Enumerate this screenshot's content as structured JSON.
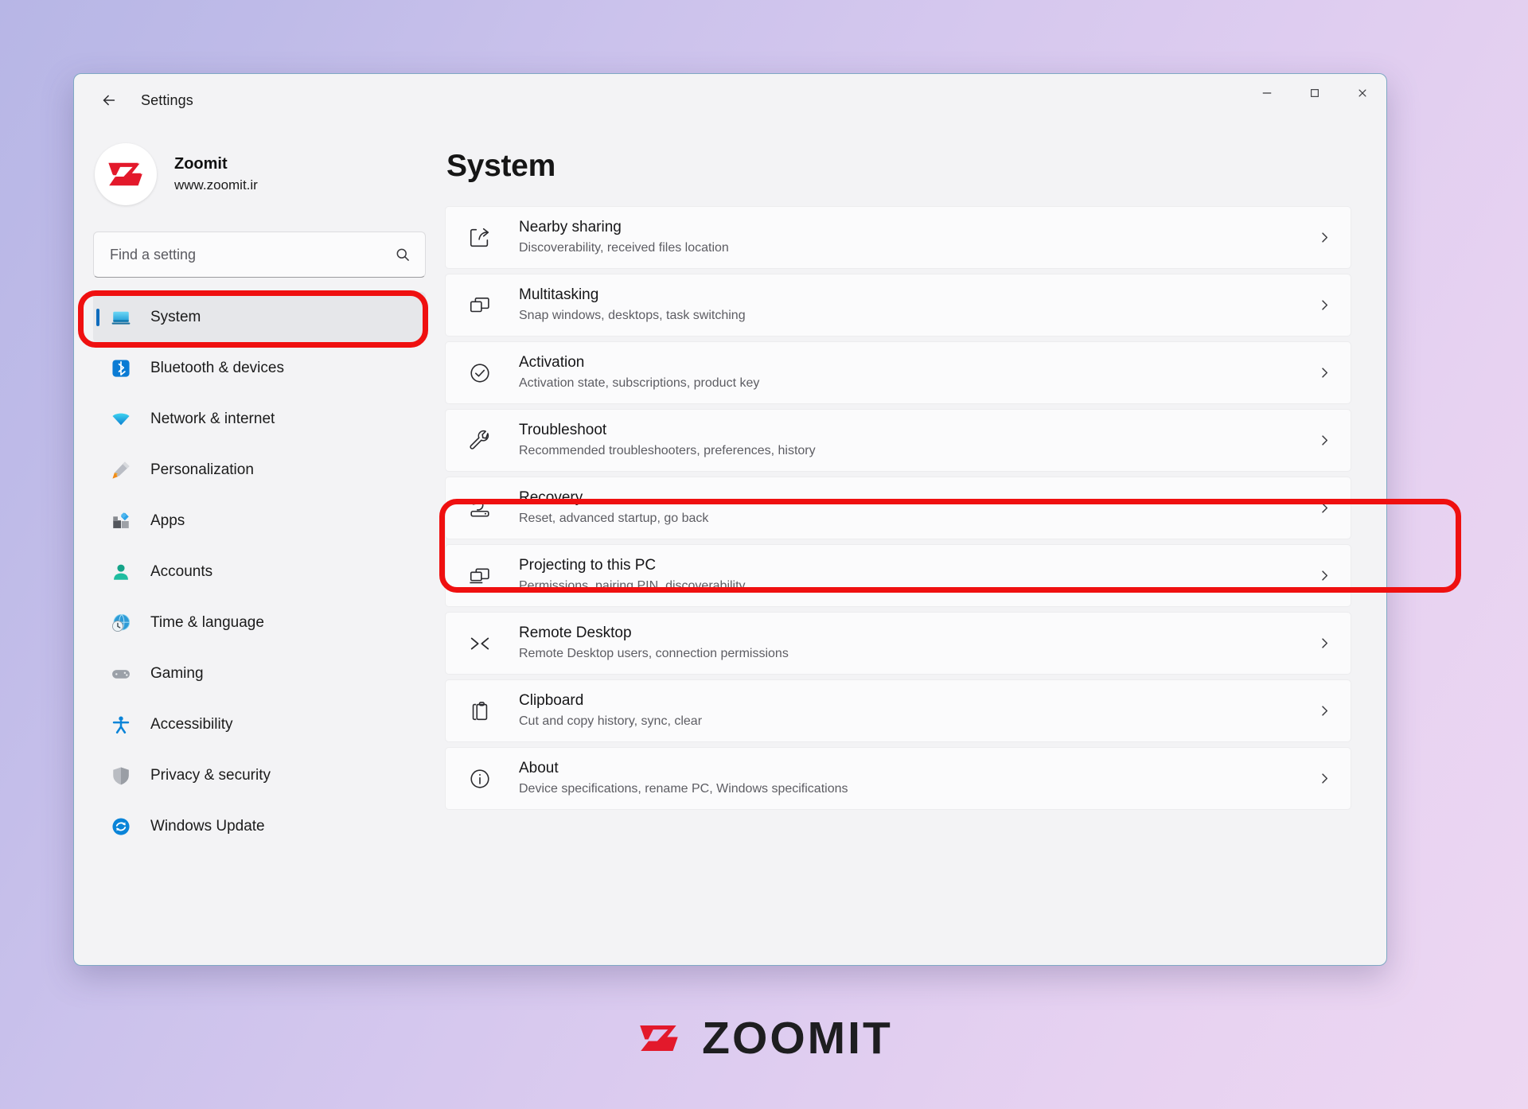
{
  "window": {
    "title": "Settings",
    "back_icon": "back-arrow-icon",
    "controls": {
      "minimize": "minimize-icon",
      "maximize": "maximize-icon",
      "close": "close-icon"
    }
  },
  "sidebar": {
    "account": {
      "name": "Zoomit",
      "url": "www.zoomit.ir",
      "avatar_icon": "zoomit-logo-icon"
    },
    "search": {
      "placeholder": "Find a setting",
      "value": "",
      "icon": "search-icon"
    },
    "items": [
      {
        "label": "System",
        "icon": "monitor-icon",
        "active": true
      },
      {
        "label": "Bluetooth & devices",
        "icon": "bluetooth-icon",
        "active": false
      },
      {
        "label": "Network & internet",
        "icon": "wifi-icon",
        "active": false
      },
      {
        "label": "Personalization",
        "icon": "paintbrush-icon",
        "active": false
      },
      {
        "label": "Apps",
        "icon": "apps-icon",
        "active": false
      },
      {
        "label": "Accounts",
        "icon": "person-icon",
        "active": false
      },
      {
        "label": "Time & language",
        "icon": "clock-globe-icon",
        "active": false
      },
      {
        "label": "Gaming",
        "icon": "gamepad-icon",
        "active": false
      },
      {
        "label": "Accessibility",
        "icon": "accessibility-icon",
        "active": false
      },
      {
        "label": "Privacy & security",
        "icon": "shield-icon",
        "active": false
      },
      {
        "label": "Windows Update",
        "icon": "update-icon",
        "active": false
      }
    ]
  },
  "main": {
    "page_title": "System",
    "cards": [
      {
        "title": "Nearby sharing",
        "subtitle": "Discoverability, received files location",
        "icon": "share-icon",
        "chevron": "chevron-right-icon",
        "highlighted": false
      },
      {
        "title": "Multitasking",
        "subtitle": "Snap windows, desktops, task switching",
        "icon": "windows-stack-icon",
        "chevron": "chevron-right-icon",
        "highlighted": false
      },
      {
        "title": "Activation",
        "subtitle": "Activation state, subscriptions, product key",
        "icon": "check-circle-icon",
        "chevron": "chevron-right-icon",
        "highlighted": false
      },
      {
        "title": "Troubleshoot",
        "subtitle": "Recommended troubleshooters, preferences, history",
        "icon": "wrench-icon",
        "chevron": "chevron-right-icon",
        "highlighted": false
      },
      {
        "title": "Recovery",
        "subtitle": "Reset, advanced startup, go back",
        "icon": "recovery-icon",
        "chevron": "chevron-right-icon",
        "highlighted": true
      },
      {
        "title": "Projecting to this PC",
        "subtitle": "Permissions, pairing PIN, discoverability",
        "icon": "projecting-icon",
        "chevron": "chevron-right-icon",
        "highlighted": false
      },
      {
        "title": "Remote Desktop",
        "subtitle": "Remote Desktop users, connection permissions",
        "icon": "remote-desktop-icon",
        "chevron": "chevron-right-icon",
        "highlighted": false
      },
      {
        "title": "Clipboard",
        "subtitle": "Cut and copy history, sync, clear",
        "icon": "clipboard-icon",
        "chevron": "chevron-right-icon",
        "highlighted": false
      },
      {
        "title": "About",
        "subtitle": "Device specifications, rename PC, Windows specifications",
        "icon": "info-icon",
        "chevron": "chevron-right-icon",
        "highlighted": false
      }
    ]
  },
  "annotations": {
    "highlight_color": "#ef1010",
    "targets": [
      "sidebar-item-system",
      "card-recovery"
    ]
  },
  "footer": {
    "logo_text": "ZOOMIT",
    "logo_mark_icon": "zoomit-logo-icon"
  },
  "theme": {
    "background_from": "#b7b6e6",
    "background_to": "#edd7f2",
    "accent": "#0f6cbd",
    "brand_red": "#e3192b"
  }
}
